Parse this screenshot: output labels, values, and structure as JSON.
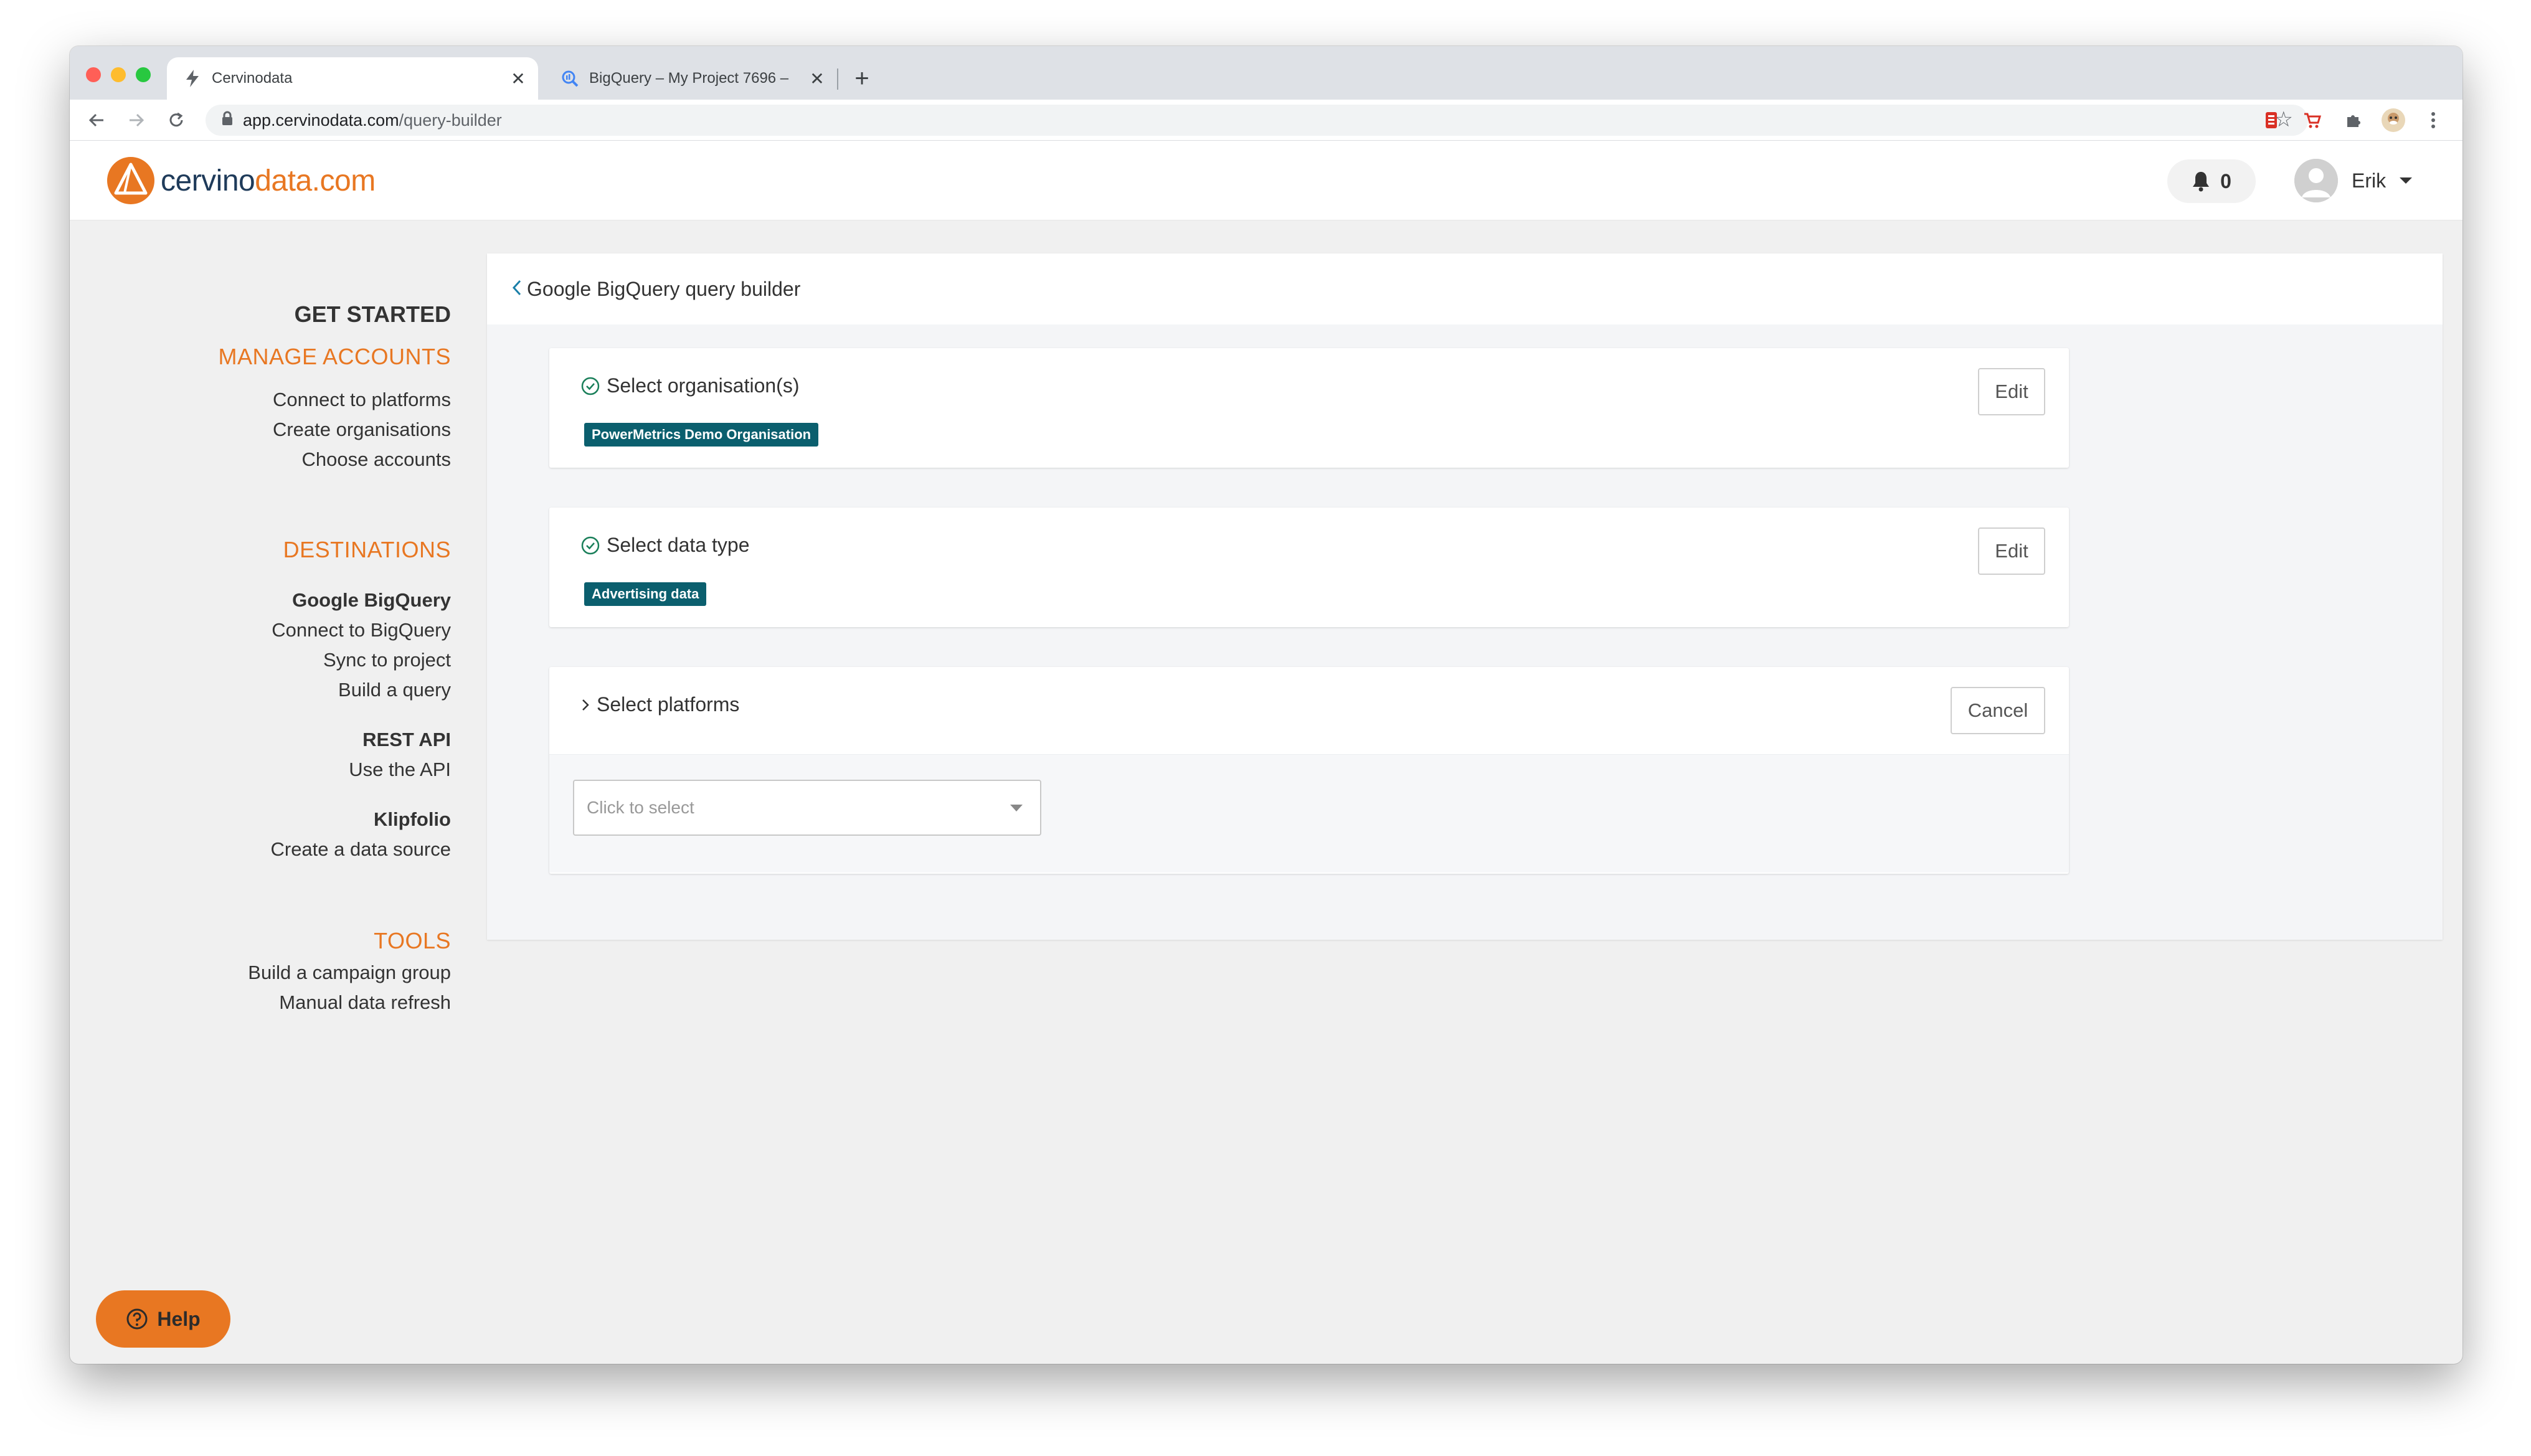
{
  "browser": {
    "tabs": [
      {
        "title": "Cervinodata",
        "active": true,
        "favicon": "bolt-icon"
      },
      {
        "title": "BigQuery – My Project 7696 –",
        "active": false,
        "favicon": "bigquery-icon"
      }
    ],
    "url_host": "app.cervinodata.com",
    "url_path": "/query-builder"
  },
  "header": {
    "logo_part1": "cervino",
    "logo_part2": "data.com",
    "notification_count": "0",
    "user_name": "Erik"
  },
  "sidebar": {
    "get_started": "GET STARTED",
    "manage_accounts": "MANAGE ACCOUNTS",
    "connect_platforms": "Connect to platforms",
    "create_organisations": "Create organisations",
    "choose_accounts": "Choose accounts",
    "destinations": "DESTINATIONS",
    "google_bigquery": "Google BigQuery",
    "connect_bigquery": "Connect to BigQuery",
    "sync_project": "Sync to project",
    "build_query": "Build a query",
    "rest_api": "REST API",
    "use_api": "Use the API",
    "klipfolio": "Klipfolio",
    "create_data_source": "Create a data source",
    "tools": "TOOLS",
    "build_campaign_group": "Build a campaign group",
    "manual_refresh": "Manual data refresh"
  },
  "main": {
    "title": "Google BigQuery query builder",
    "steps": [
      {
        "title": "Select organisation(s)",
        "badge": "PowerMetrics Demo Organisation",
        "button": "Edit",
        "completed": true
      },
      {
        "title": "Select data type",
        "badge": "Advertising data",
        "button": "Edit",
        "completed": true
      },
      {
        "title": "Select platforms",
        "button": "Cancel",
        "placeholder": "Click to select",
        "completed": false
      }
    ]
  },
  "help_label": "Help",
  "colors": {
    "accent": "#e87722",
    "brand_dark": "#1f3b5a",
    "badge": "#0b5f6e",
    "check": "#1a7f5a"
  }
}
